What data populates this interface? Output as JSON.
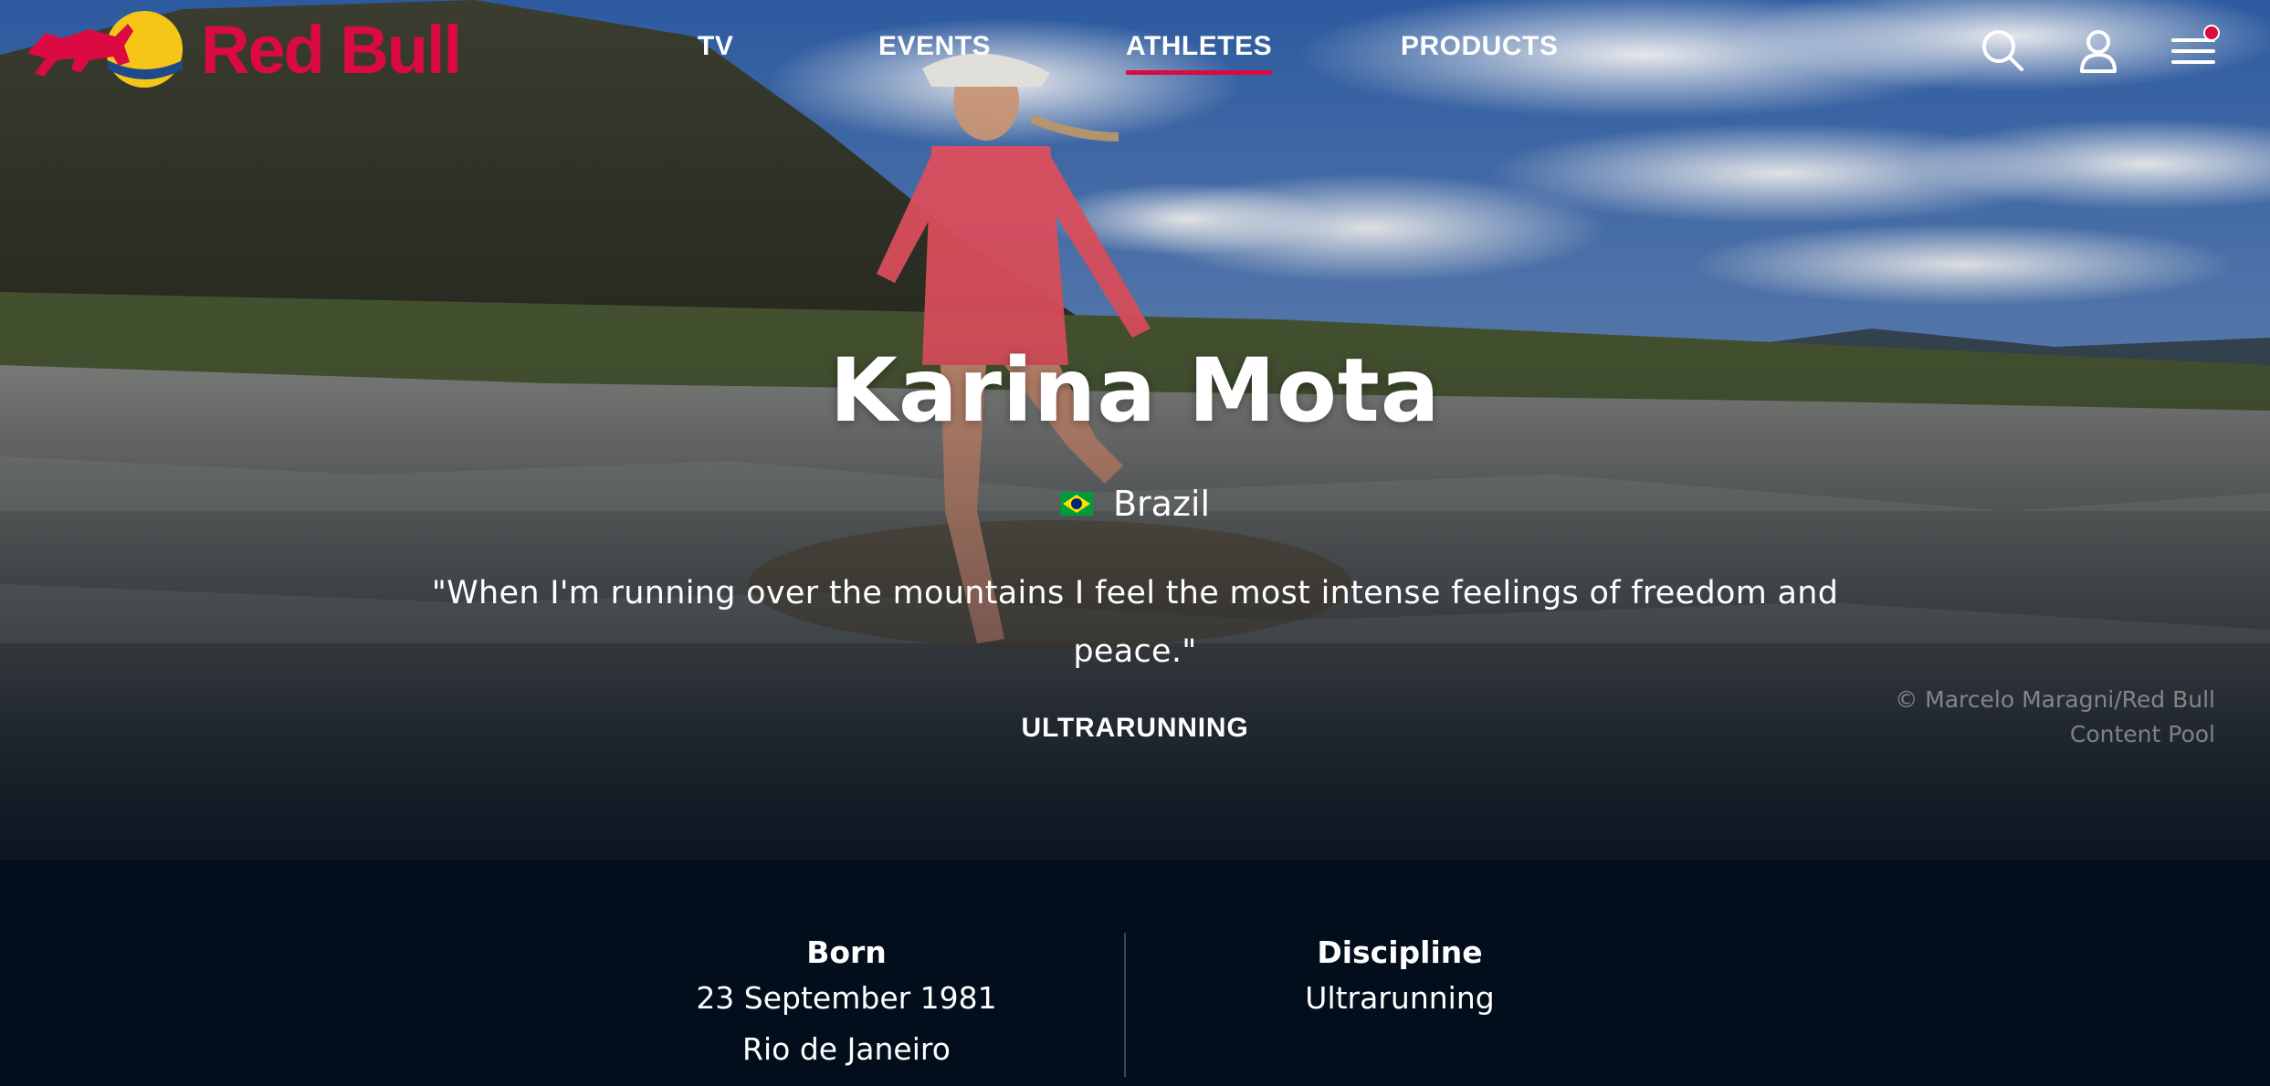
{
  "brand": {
    "name": "Red Bull",
    "color": "#db0a40",
    "logo_icon": "red-bull-logo"
  },
  "nav": {
    "items": [
      {
        "label": "TV",
        "active": false
      },
      {
        "label": "EVENTS",
        "active": false
      },
      {
        "label": "ATHLETES",
        "active": true
      },
      {
        "label": "PRODUCTS",
        "active": false
      }
    ],
    "active_color": "#db0a40"
  },
  "header_icons": {
    "search": "search-icon",
    "account": "user-icon",
    "menu": "hamburger-menu-icon",
    "menu_badge_color": "#db0a40"
  },
  "hero": {
    "name": "Karina Mota",
    "country": {
      "name": "Brazil",
      "flag_icon": "brazil-flag-icon"
    },
    "quote": "\"When I'm running over the mountains I feel the most intense feelings of freedom and peace.\"",
    "sport": "ULTRARUNNING",
    "credit_line1": "© Marcelo Maragni/Red Bull",
    "credit_line2": "Content Pool"
  },
  "details": {
    "born": {
      "label": "Born",
      "date": "23 September 1981",
      "place": "Rio de Janeiro"
    },
    "discipline": {
      "label": "Discipline",
      "value": "Ultrarunning"
    }
  },
  "colors": {
    "page_background": "#020e1c",
    "divider": "#3a4656"
  }
}
